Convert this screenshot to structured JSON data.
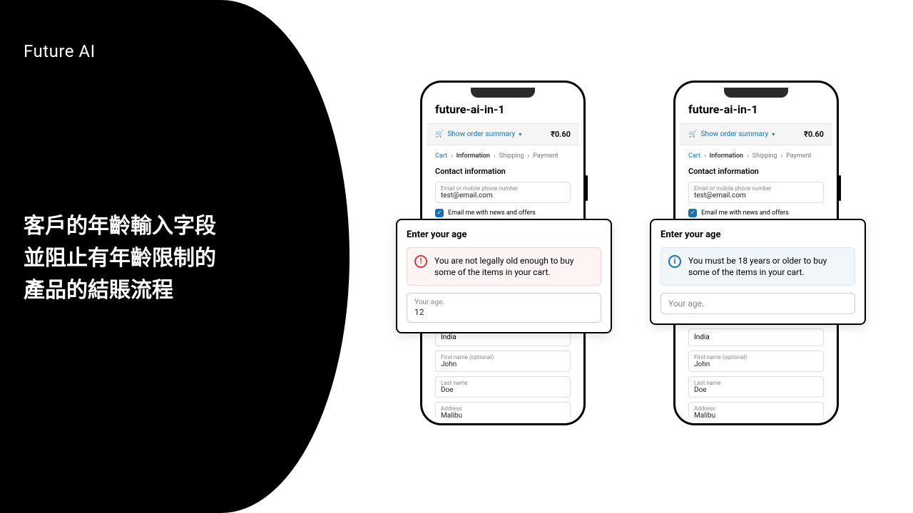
{
  "brand": "Future AI",
  "headline_l1": "客戶的年齡輸入字段",
  "headline_l2": "並阻止有年齡限制的",
  "headline_l3": "產品的結賬流程",
  "store": "future-ai-in-1",
  "summary_label": "Show order summary",
  "price": "₹0.60",
  "crumbs": {
    "cart": "Cart",
    "info": "Information",
    "ship": "Shipping",
    "pay": "Payment",
    "sep": "›"
  },
  "contact_heading": "Contact information",
  "email_label": "Email or mobile phone number",
  "email_value": "test@email.com",
  "news_label": "Email me with news and offers",
  "country_value": "India",
  "first_label": "First name (optional)",
  "first_value": "John",
  "last_label": "Last name",
  "last_value": "Doe",
  "addr_label": "Address",
  "addr_value": "Malibu",
  "popup": {
    "title": "Enter your age",
    "err_msg": "You are not legally old enough to buy some of the items in your cart.",
    "info_msg": "You must be 18 years or older to buy some of the items in your cart.",
    "age_label": "Your age.",
    "age_value": "12"
  }
}
